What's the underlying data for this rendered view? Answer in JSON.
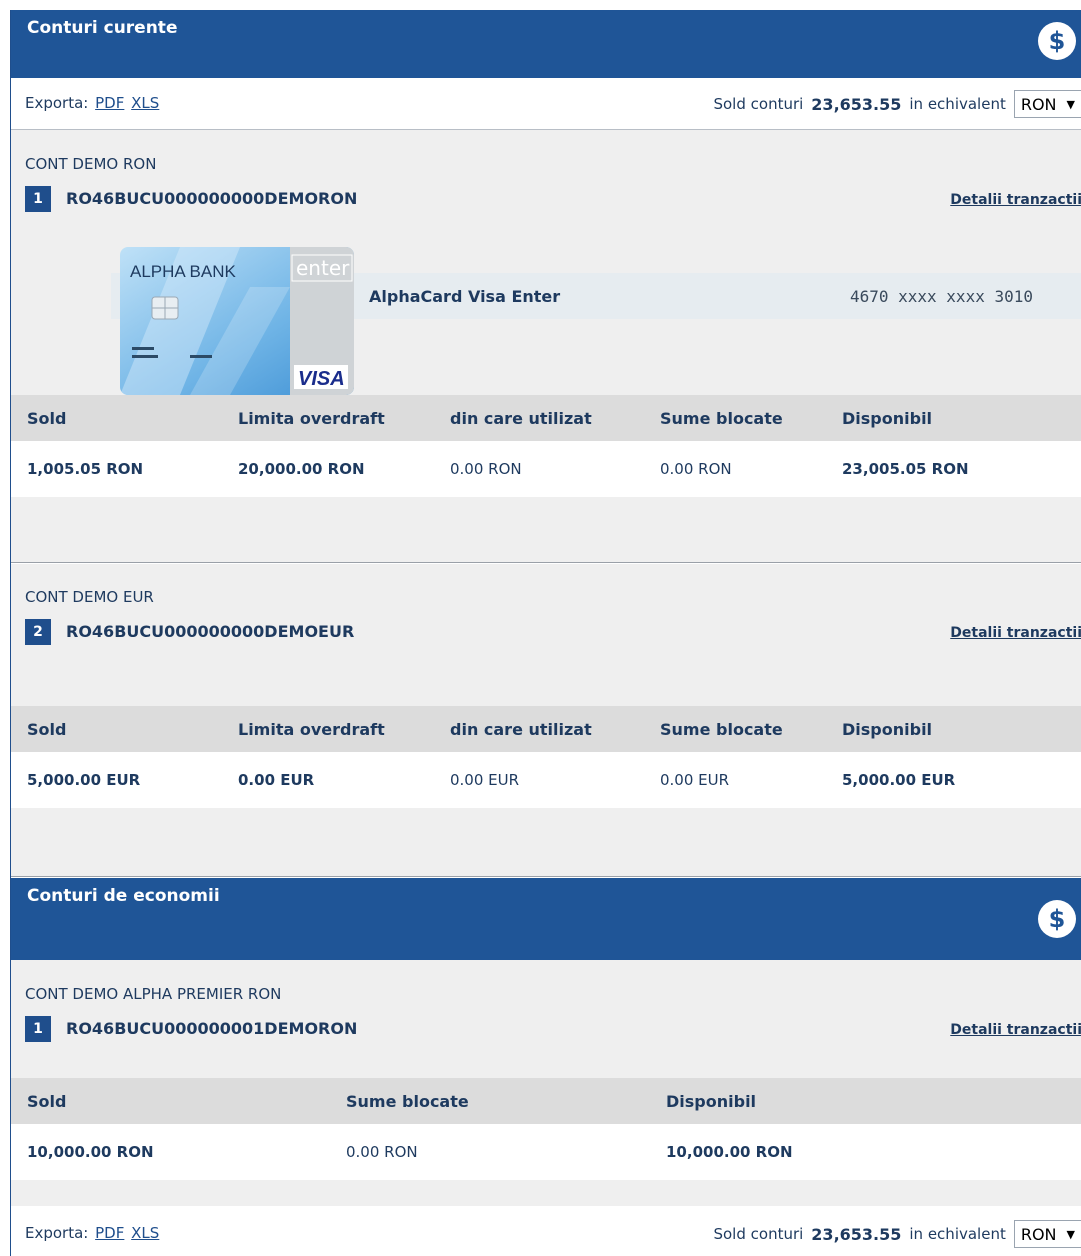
{
  "current_accounts": {
    "title": "Conturi curente",
    "icon": "dollar-icon",
    "dollar_symbol": "$",
    "export": {
      "label": "Exporta:",
      "pdf": "PDF",
      "xls": "XLS"
    },
    "balance": {
      "label": "Sold conturi",
      "amount": "23,653.55",
      "equiv_label": "in echivalent",
      "currency": "RON"
    },
    "accounts": [
      {
        "name": "CONT DEMO RON",
        "index": "1",
        "iban": "RO46BUCU000000000DEMORON",
        "details_link": "Detalii tranzactii",
        "card": {
          "bank": "ALPHA BANK",
          "brand": "enter",
          "network": "VISA",
          "name": "AlphaCard Visa Enter",
          "number": "4670 xxxx xxxx 3010"
        },
        "headers": [
          "Sold",
          "Limita overdraft",
          "din care utilizat",
          "Sume blocate",
          "Disponibil"
        ],
        "values": [
          "1,005.05 RON",
          "20,000.00 RON",
          "0.00 RON",
          "0.00 RON",
          "23,005.05 RON"
        ]
      },
      {
        "name": "CONT DEMO EUR",
        "index": "2",
        "iban": "RO46BUCU000000000DEMOEUR",
        "details_link": "Detalii tranzactii",
        "headers": [
          "Sold",
          "Limita overdraft",
          "din care utilizat",
          "Sume blocate",
          "Disponibil"
        ],
        "values": [
          "5,000.00 EUR",
          "0.00 EUR",
          "0.00 EUR",
          "0.00 EUR",
          "5,000.00 EUR"
        ]
      }
    ]
  },
  "savings_accounts": {
    "title": "Conturi de economii",
    "icon": "dollar-icon",
    "dollar_symbol": "$",
    "accounts": [
      {
        "name": "CONT DEMO ALPHA PREMIER RON",
        "index": "1",
        "iban": "RO46BUCU000000001DEMORON",
        "details_link": "Detalii tranzactii",
        "headers": [
          "Sold",
          "Sume blocate",
          "Disponibil"
        ],
        "values": [
          "10,000.00  RON",
          "0.00  RON",
          "10,000.00  RON"
        ]
      }
    ],
    "export": {
      "label": "Exporta:",
      "pdf": "PDF",
      "xls": "XLS"
    },
    "balance": {
      "label": "Sold conturi",
      "amount": "23,653.55",
      "equiv_label": "in echivalent",
      "currency": "RON"
    }
  },
  "colors": {
    "header_blue": "#1f5597",
    "overdraft_orange": "#ff6a13",
    "row_gray": "#efefef"
  }
}
